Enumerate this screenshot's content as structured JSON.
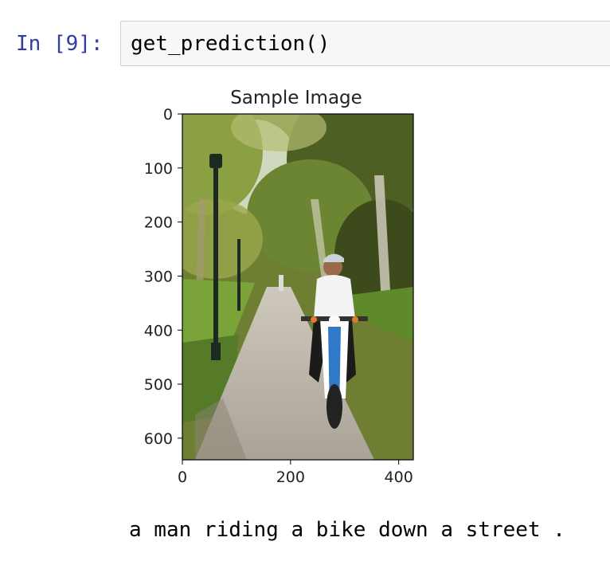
{
  "cell": {
    "prompt": "In [9]:",
    "code": "get_prediction()"
  },
  "figure": {
    "image_icon": "photo-of-man-riding-motorbike-on-tree-lined-path",
    "colors": {
      "sky": "#dfe9d6",
      "foliage_dark": "#3c4a1c",
      "foliage_light": "#8aa043",
      "grass": "#5e8a2a",
      "path": "#b9b2a6",
      "shirt": "#f3f3f3",
      "bike_blue": "#2f79c8",
      "lamp_post": "#1c2a22"
    }
  },
  "chart_data": {
    "type": "image",
    "title": "Sample Image",
    "xlabel": "",
    "ylabel": "",
    "xlim": [
      0,
      427
    ],
    "ylim": [
      640,
      0
    ],
    "xticks": [
      0,
      200,
      400
    ],
    "yticks": [
      0,
      100,
      200,
      300,
      400,
      500,
      600
    ],
    "xtick_labels": [
      "0",
      "200",
      "400"
    ],
    "ytick_labels": [
      "0",
      "100",
      "200",
      "300",
      "400",
      "500",
      "600"
    ],
    "grid": false
  },
  "output": {
    "caption": "a man riding a bike down a street ."
  }
}
